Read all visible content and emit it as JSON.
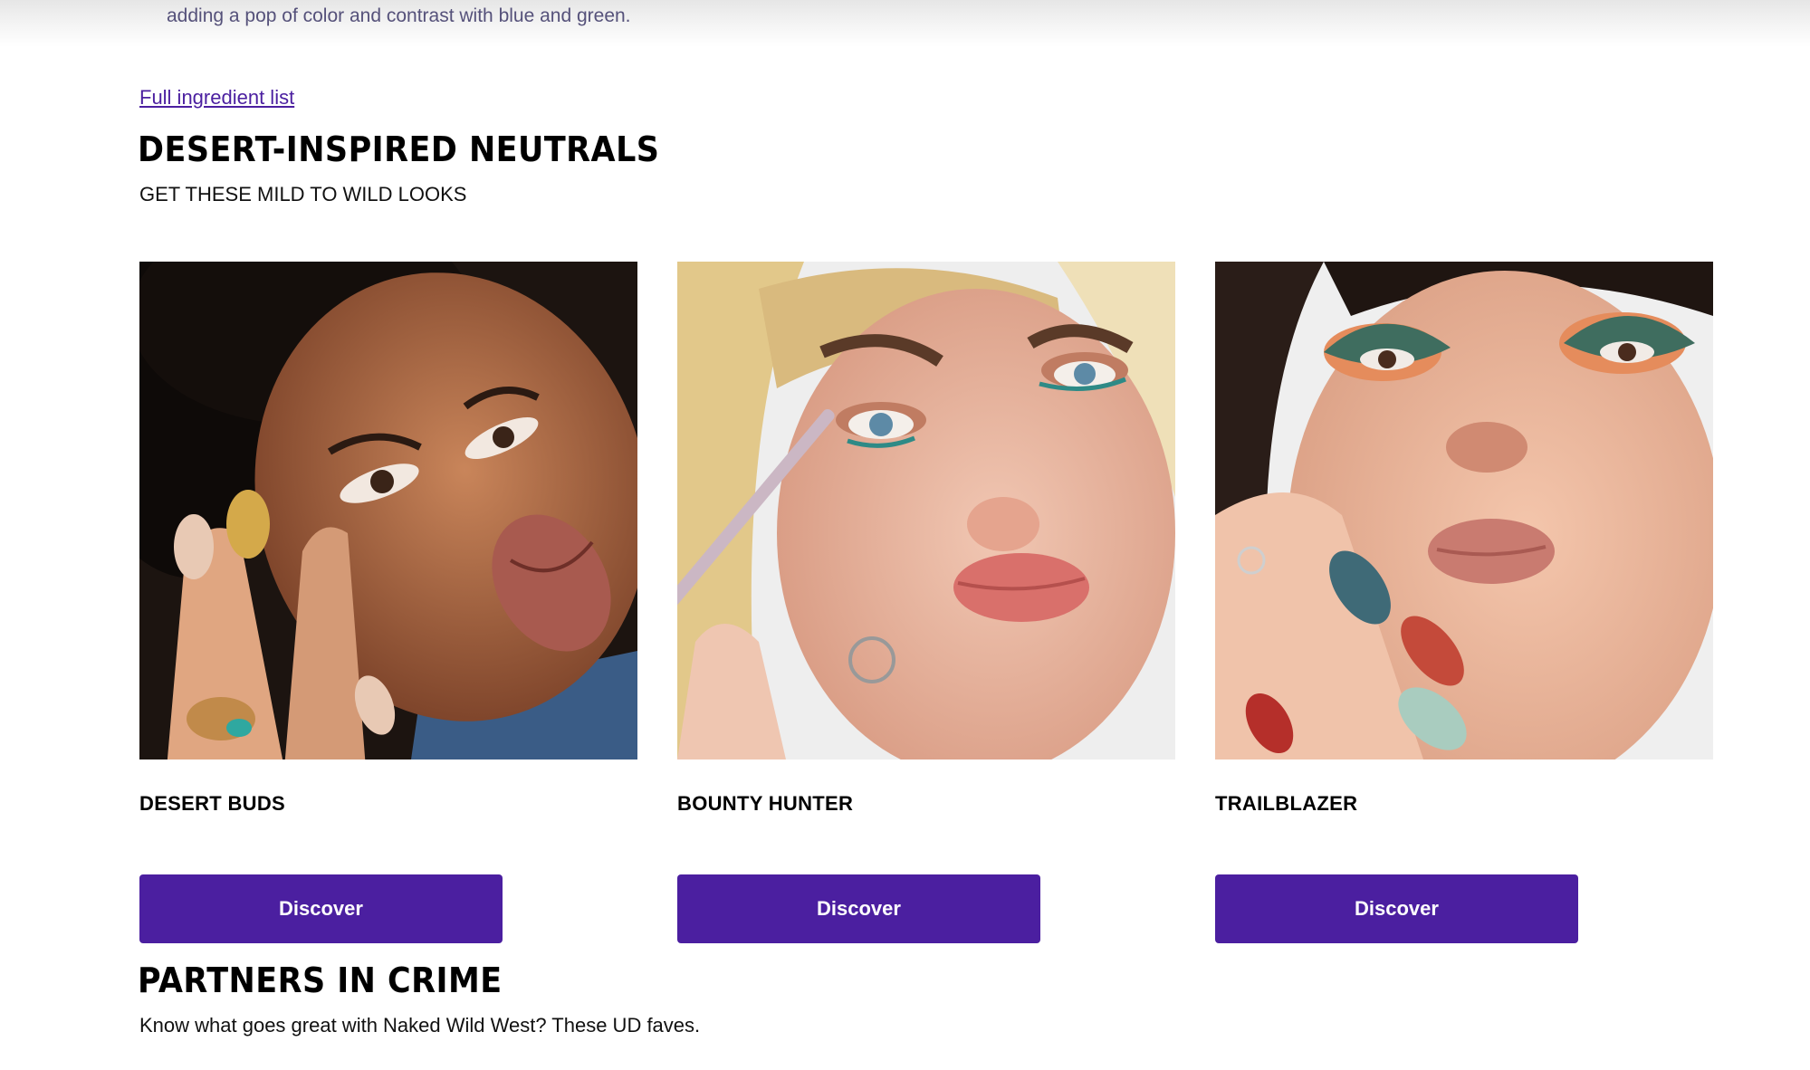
{
  "intro": {
    "tail_text": "adding a pop of color and contrast with blue and green."
  },
  "ingredient_link": "Full ingredient list",
  "looks_section": {
    "title": "DESERT-INSPIRED NEUTRALS",
    "subtitle": "GET THESE MILD TO WILD LOOKS",
    "cards": [
      {
        "name": "DESERT BUDS",
        "button": "Discover"
      },
      {
        "name": "BOUNTY HUNTER",
        "button": "Discover"
      },
      {
        "name": "TRAILBLAZER",
        "button": "Discover"
      }
    ]
  },
  "partners_section": {
    "title": "PARTNERS IN CRIME",
    "subtitle": "Know what goes great with Naked Wild West? These UD faves."
  },
  "colors": {
    "accent": "#4b1fa0",
    "intro_text": "#55517a"
  }
}
